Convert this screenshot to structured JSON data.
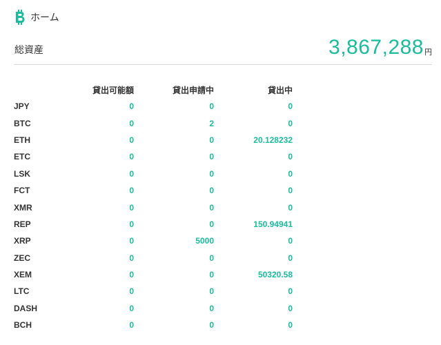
{
  "header": {
    "title": "ホーム",
    "logo_icon": "bitcoin-icon",
    "logo_color": "#1abc9c"
  },
  "assets": {
    "label": "総資産",
    "amount": "3,867,288",
    "unit": "円",
    "accent": "#1abc9c"
  },
  "table": {
    "headers": [
      "",
      "貸出可能額",
      "貸出申請中",
      "貸出中"
    ],
    "rows": [
      {
        "symbol": "JPY",
        "available": "0",
        "pending": "0",
        "lent": "0"
      },
      {
        "symbol": "BTC",
        "available": "0",
        "pending": "2",
        "lent": "0"
      },
      {
        "symbol": "ETH",
        "available": "0",
        "pending": "0",
        "lent": "20.128232"
      },
      {
        "symbol": "ETC",
        "available": "0",
        "pending": "0",
        "lent": "0"
      },
      {
        "symbol": "LSK",
        "available": "0",
        "pending": "0",
        "lent": "0"
      },
      {
        "symbol": "FCT",
        "available": "0",
        "pending": "0",
        "lent": "0"
      },
      {
        "symbol": "XMR",
        "available": "0",
        "pending": "0",
        "lent": "0"
      },
      {
        "symbol": "REP",
        "available": "0",
        "pending": "0",
        "lent": "150.94941"
      },
      {
        "symbol": "XRP",
        "available": "0",
        "pending": "5000",
        "lent": "0"
      },
      {
        "symbol": "ZEC",
        "available": "0",
        "pending": "0",
        "lent": "0"
      },
      {
        "symbol": "XEM",
        "available": "0",
        "pending": "0",
        "lent": "50320.58"
      },
      {
        "symbol": "LTC",
        "available": "0",
        "pending": "0",
        "lent": "0"
      },
      {
        "symbol": "DASH",
        "available": "0",
        "pending": "0",
        "lent": "0"
      },
      {
        "symbol": "BCH",
        "available": "0",
        "pending": "0",
        "lent": "0"
      }
    ]
  }
}
